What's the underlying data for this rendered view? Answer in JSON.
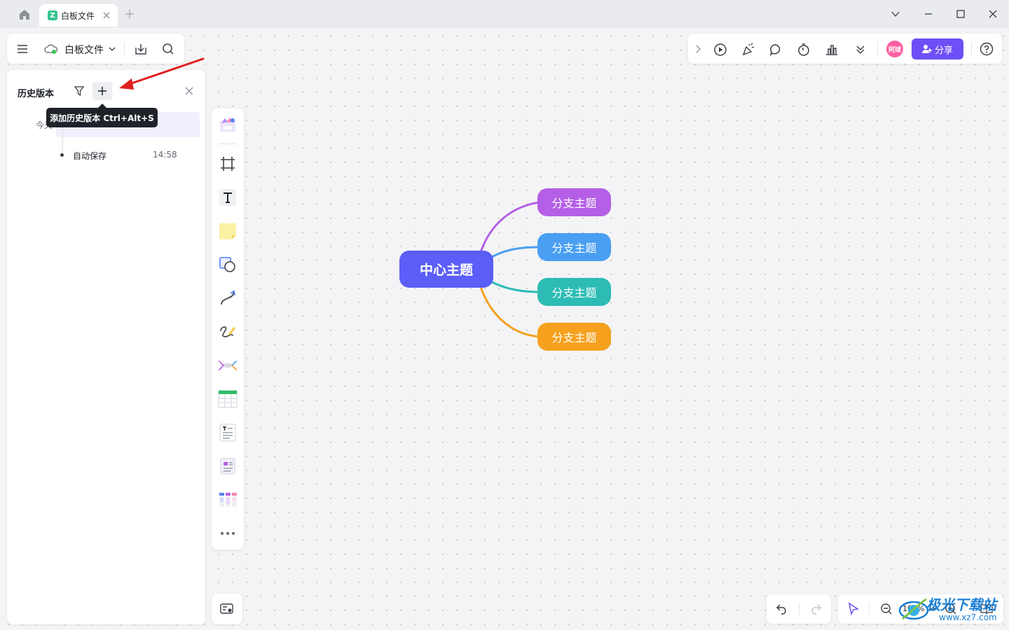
{
  "titlebar": {
    "tab_title": "白板文件",
    "tab_logo": "Z"
  },
  "toolbar": {
    "file_title": "白板文件"
  },
  "right_toolbar": {
    "avatar_text": "阿球",
    "share_label": "分享"
  },
  "history_panel": {
    "title": "历史版本",
    "group_today": "今天",
    "items": [
      {
        "label": "自动保存",
        "time": "14:58"
      }
    ],
    "tooltip": "添加历史版本 Ctrl+Alt+S"
  },
  "zoom": {
    "level": "100%"
  },
  "mindmap": {
    "center": "中心主题",
    "branches": [
      {
        "label": "分支主题",
        "color": "#b45fe6"
      },
      {
        "label": "分支主题",
        "color": "#4a9ff2"
      },
      {
        "label": "分支主题",
        "color": "#2dbcb5"
      },
      {
        "label": "分支主题",
        "color": "#f5a11e"
      }
    ]
  },
  "watermark": {
    "text": "极光下载站",
    "url": "www.xz7.com"
  },
  "colors": {
    "accent": "#6e4ff6",
    "center_node": "#5b5ef7",
    "annotation_arrow": "#e02020"
  }
}
